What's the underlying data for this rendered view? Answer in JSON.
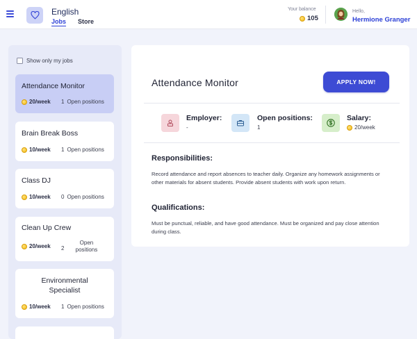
{
  "header": {
    "app_title": "English",
    "tabs": [
      {
        "label": "Jobs",
        "active": true
      },
      {
        "label": "Store",
        "active": false
      }
    ],
    "balance_label": "Your balance",
    "balance_value": "105",
    "greeting": "Hello,",
    "user_name": "Hermione Granger"
  },
  "sidebar": {
    "filter_label": "Show only my jobs",
    "filter_checked": false,
    "jobs": [
      {
        "title": "Attendance Monitor",
        "wage": "20/week",
        "open_count": "1",
        "open_text": "Open positions",
        "selected": true
      },
      {
        "title": "Brain Break Boss",
        "wage": "10/week",
        "open_count": "1",
        "open_text": "Open positions"
      },
      {
        "title": "Class DJ",
        "wage": "10/week",
        "open_count": "0",
        "open_text": "Open positions"
      },
      {
        "title": "Clean Up Crew",
        "wage": "20/week",
        "open_count": "2",
        "open_text": "Open positions"
      },
      {
        "title": "Environmental Specialist",
        "wage": "10/week",
        "open_count": "1",
        "open_text": "Open positions"
      }
    ]
  },
  "detail": {
    "title": "Attendance Monitor",
    "apply_label": "APPLY NOW!",
    "employer_label": "Employer:",
    "employer_value": "-",
    "open_positions_label": "Open positions:",
    "open_positions_value": "1",
    "salary_label": "Salary:",
    "salary_value": "20/week",
    "responsibilities_heading": "Responsibilities:",
    "responsibilities_text": "Record attendance and report absences to teacher daily. Organize any homework assignments or other materials for absent students. Provide absent students with work upon return.",
    "qualifications_heading": "Qualifications:",
    "qualifications_text": "Must be punctual, reliable, and have good attendance. Must be organized and pay close attention during class."
  },
  "colors": {
    "accent": "#3d4bd4",
    "selected_card": "#c8cef5",
    "sidebar_bg": "#e7eaf8",
    "employer_icon_bg": "#f6d6db",
    "positions_icon_bg": "#d3e6f7",
    "salary_icon_bg": "#d6eeca",
    "coin": "#f2b915"
  },
  "icons": [
    "menu-icon",
    "heart-icon",
    "coin-icon",
    "user-avatar",
    "employer-icon",
    "briefcase-icon",
    "dollar-icon"
  ]
}
